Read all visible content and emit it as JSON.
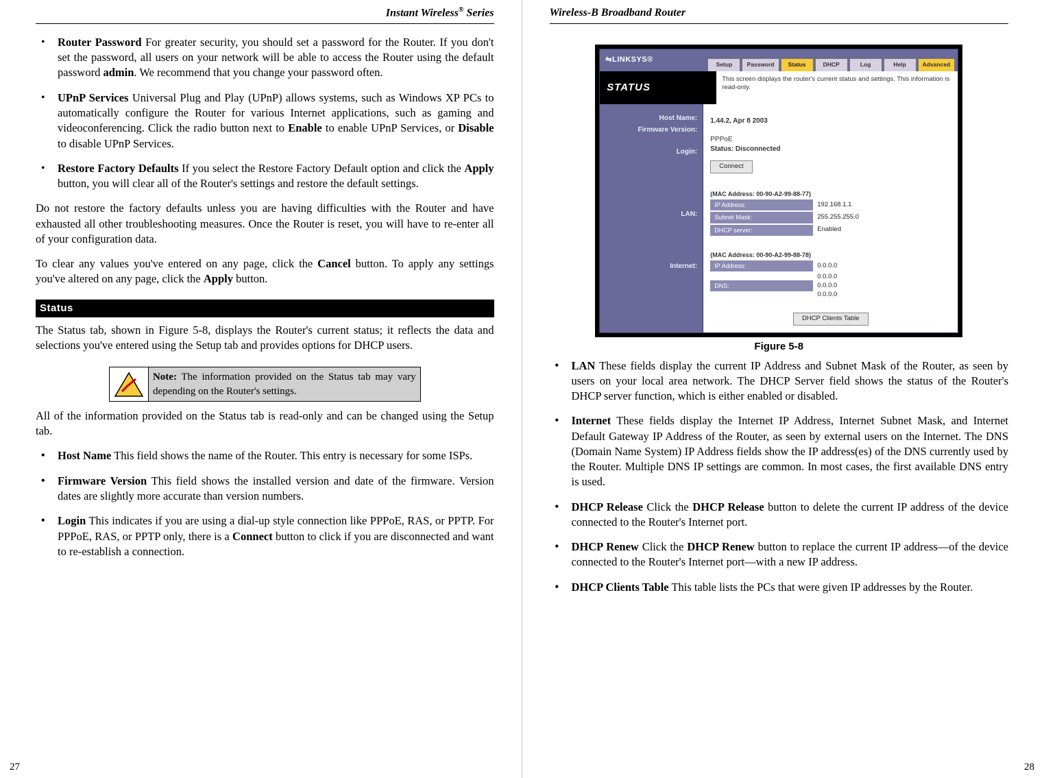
{
  "left": {
    "header": "Instant Wireless® Series",
    "pageNum": "27",
    "bullets1": [
      {
        "title": "Router Password",
        "text": "  For greater security, you should set a password for the Router. If you don't set the password, all users on your network will be able to access the Router using the default password admin. We recommend that you change your password often."
      },
      {
        "title": "UPnP Services",
        "text": " Universal Plug and Play (UPnP) allows systems, such as Windows XP PCs to automatically configure the Router for various Internet applications, such as gaming and videoconferencing. Click the radio button next to Enable to enable UPnP Services, or Disable to disable UPnP Services."
      },
      {
        "title": "Restore Factory Defaults",
        "text": "  If you select the Restore Factory Default option and click the Apply button, you will clear all of the Router's settings and restore the default settings."
      }
    ],
    "para1": "Do not restore the factory defaults unless you are having difficulties with the Router and have exhausted all other troubleshooting measures. Once the Router is reset, you will have to re-enter all of your configuration data.",
    "para2": "To clear any values you've entered on any page, click  the Cancel button.  To apply any settings you've altered on any page, click the Apply button.",
    "sectionBar": "Status",
    "para3": "The Status tab, shown in Figure 5-8, displays the Router's current status; it reflects the data and selections you've entered using the Setup tab and provides options for DHCP users.",
    "note": "Note: The information provided on the Status tab may vary depending on the Router's settings.",
    "para4": "All of the information provided on the Status tab is read-only and can be changed using the Setup tab.",
    "bullets2": [
      {
        "title": "Host Name",
        "text": "  This field shows the name of the Router. This entry is necessary for some ISPs."
      },
      {
        "title": "Firmware Version",
        "text": "  This field shows the installed version and date of the firmware.  Version dates are slightly more accurate than version numbers."
      },
      {
        "title": "Login",
        "text": "  This indicates if you are using a dial-up style connection like PPPoE, RAS, or PPTP. For PPPoE, RAS, or PPTP only, there is a Connect button to click if you are disconnected and want to re-establish a connection."
      }
    ]
  },
  "right": {
    "header": "Wireless-B Broadband Router",
    "pageNum": "28",
    "figCaption": "Figure 5-8",
    "bullets": [
      {
        "title": "LAN",
        "text": "  These fields display the current IP Address and Subnet Mask of the Router, as seen by users on your local area network. The DHCP Server field shows the status of the Router's DHCP server function, which is either enabled or disabled."
      },
      {
        "title": "Internet",
        "text": "  These fields display the Internet IP Address, Internet  Subnet Mask, and Internet  Default Gateway IP Address of the Router, as seen by external users on the Internet. The DNS (Domain Name System) IP Address fields show the IP address(es) of the DNS currently used by the Router. Multiple DNS IP settings are common. In most cases, the first available DNS entry is used."
      },
      {
        "title": "DHCP Release",
        "text": "  Click the DHCP Release button to delete the current IP address of the device connected to the Router's Internet port."
      },
      {
        "title": "DHCP Renew",
        "text": "  Click the DHCP Renew button to replace the current IP address—of the device connected to the Router's Internet port—with a new IP address."
      },
      {
        "title": "DHCP Clients Table",
        "text": "  This table lists the PCs that were given IP addresses by the Router."
      }
    ]
  },
  "router": {
    "logo": "LINKSYS®",
    "tabs": [
      "Setup",
      "Password",
      "Status",
      "DHCP",
      "Log",
      "Help"
    ],
    "advTab": "Advanced",
    "sideTitle": "STATUS",
    "desc": "This screen displays the router's current status and settings. This information is read-only.",
    "labels": {
      "host": "Host Name:",
      "fw": "Firmware Version:",
      "login": "Login:",
      "lan": "LAN:",
      "internet": "Internet:"
    },
    "fwVal": "1.44.2, Apr 8 2003",
    "loginType": "PPPoE",
    "loginStatus": "Status: Disconnected",
    "connectBtn": "Connect",
    "lanMac": "(MAC Address: 00-90-A2-99-88-77)",
    "lan": {
      "ipL": "IP Address:",
      "ipV": "192.168.1.1",
      "smL": "Subnet Mask:",
      "smV": "255.255.255.0",
      "dhL": "DHCP server:",
      "dhV": "Enabled"
    },
    "wanMac": "(MAC Address: 00-90-A2-99-88-78)",
    "wan": {
      "ipL": "IP Address:",
      "ipV": "0.0.0.0",
      "dnsL": "DNS:",
      "dns1": "0.0.0.0",
      "dns2": "0.0.0.0",
      "dns3": "0.0.0.0"
    },
    "clientsBtn": "DHCP Clients Table"
  }
}
